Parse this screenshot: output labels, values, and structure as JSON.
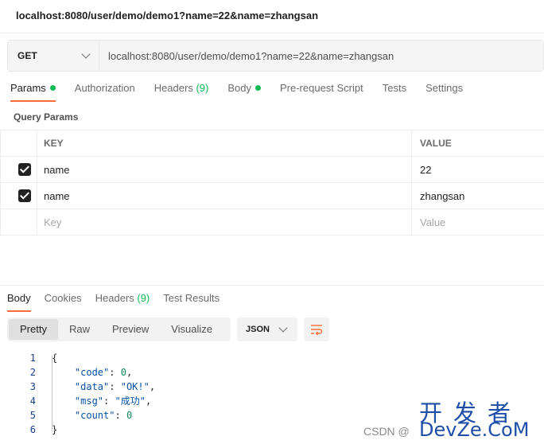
{
  "window": {
    "title": "localhost:8080/user/demo/demo1?name=22&name=zhangsan"
  },
  "request": {
    "method": "GET",
    "url": "localhost:8080/user/demo/demo1?name=22&name=zhangsan",
    "tabs": [
      {
        "label": "Params"
      },
      {
        "label": "Authorization"
      },
      {
        "label": "Headers",
        "count": "(9)"
      },
      {
        "label": "Body"
      },
      {
        "label": "Pre-request Script"
      },
      {
        "label": "Tests"
      },
      {
        "label": "Settings"
      }
    ],
    "params_label": "Query Params",
    "columns": {
      "key": "KEY",
      "value": "VALUE"
    },
    "rows": [
      {
        "key": "name",
        "value": "22",
        "checked": true
      },
      {
        "key": "name",
        "value": "zhangsan",
        "checked": true
      }
    ],
    "placeholder": {
      "key": "Key",
      "value": "Value"
    }
  },
  "response": {
    "tabs": [
      {
        "label": "Body"
      },
      {
        "label": "Cookies"
      },
      {
        "label": "Headers",
        "count": "(9)"
      },
      {
        "label": "Test Results"
      }
    ],
    "views": [
      "Pretty",
      "Raw",
      "Preview",
      "Visualize"
    ],
    "format": "JSON",
    "line_numbers": [
      "1",
      "2",
      "3",
      "4",
      "5",
      "6"
    ],
    "json": {
      "open": "{",
      "close": "}",
      "code_key": "\"code\"",
      "code_val": "0",
      "data_key": "\"data\"",
      "data_val": "\"OK!\"",
      "msg_key": "\"msg\"",
      "msg_val": "\"成功\"",
      "count_key": "\"count\"",
      "count_val": "0"
    }
  },
  "watermark": {
    "csdn": "CSDN @",
    "big": "开发者",
    "domain": "DevZe.CoM"
  }
}
